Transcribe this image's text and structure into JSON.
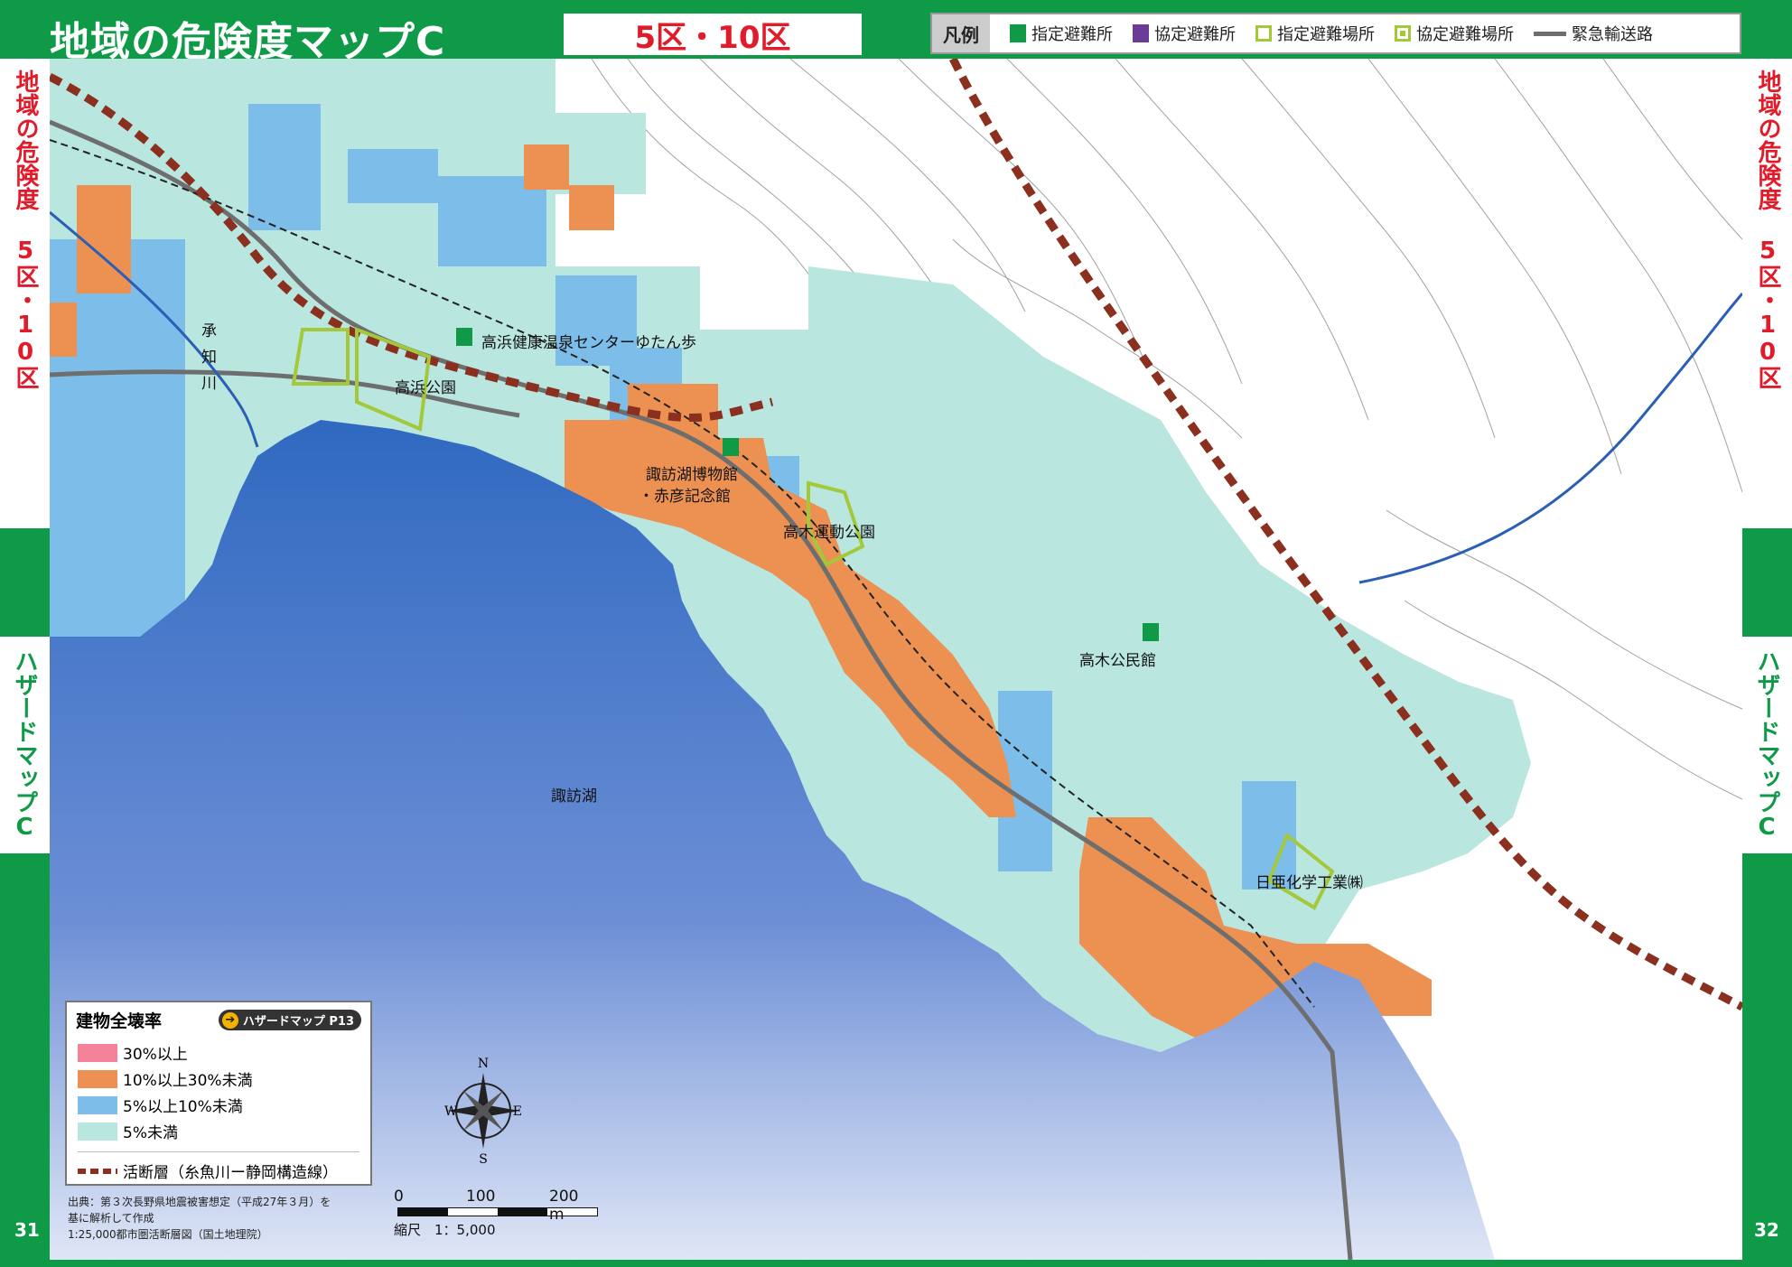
{
  "header": {
    "title": "地域の危険度マップC",
    "wards": "5区・10区"
  },
  "legend": {
    "title": "凡例",
    "items": [
      {
        "label": "指定避難所",
        "icon": "designated-shelter-icon"
      },
      {
        "label": "協定避難所",
        "icon": "agreement-shelter-icon"
      },
      {
        "label": "指定避難場所",
        "icon": "designated-evacuation-site-icon"
      },
      {
        "label": "協定避難場所",
        "icon": "agreement-evacuation-site-icon"
      },
      {
        "label": "緊急輸送路",
        "icon": "emergency-road-icon"
      }
    ]
  },
  "side": {
    "upper": "地域の危険度 5区・10区",
    "lower": "ハザードマップC"
  },
  "pages": {
    "left": "31",
    "right": "32"
  },
  "map_labels": {
    "river": "承知川",
    "onsen": "高浜健康温泉センターゆたん歩",
    "park1": "高浜公園",
    "museum1": "諏訪湖博物館",
    "museum2": "・赤彦記念館",
    "sports": "高木運動公園",
    "hall": "高木公民館",
    "lake": "諏訪湖",
    "factory": "日亜化学工業㈱"
  },
  "hazard_legend": {
    "title": "建物全壊率",
    "ref": "ハザードマップ P13",
    "items": [
      {
        "label": "30%以上",
        "color": "#f4829b"
      },
      {
        "label": "10%以上30%未満",
        "color": "#ec9152"
      },
      {
        "label": "5%以上10%未満",
        "color": "#7dbde9"
      },
      {
        "label": "5%未満",
        "color": "#b9e6df"
      }
    ],
    "fault": "活断層（糸魚川ー静岡構造線）"
  },
  "source": {
    "line1": "出典：第３次長野県地震被害想定（平成27年３月）を",
    "line2": "基に解析して作成",
    "line3": "1:25,000都市圏活断層図（国土地理院）"
  },
  "scale": {
    "ticks": [
      "0",
      "100",
      "200 m"
    ],
    "label": "縮尺　1：5,000"
  },
  "compass": {
    "n": "N",
    "s": "S",
    "e": "E",
    "w": "W"
  },
  "colors": {
    "green": "#0f9a48",
    "red": "#e11b2a",
    "lake": "#3f73c4",
    "orange": "#ec9152",
    "blue": "#7dbde9",
    "teal": "#b9e6df",
    "fault": "#8b2f1f"
  }
}
